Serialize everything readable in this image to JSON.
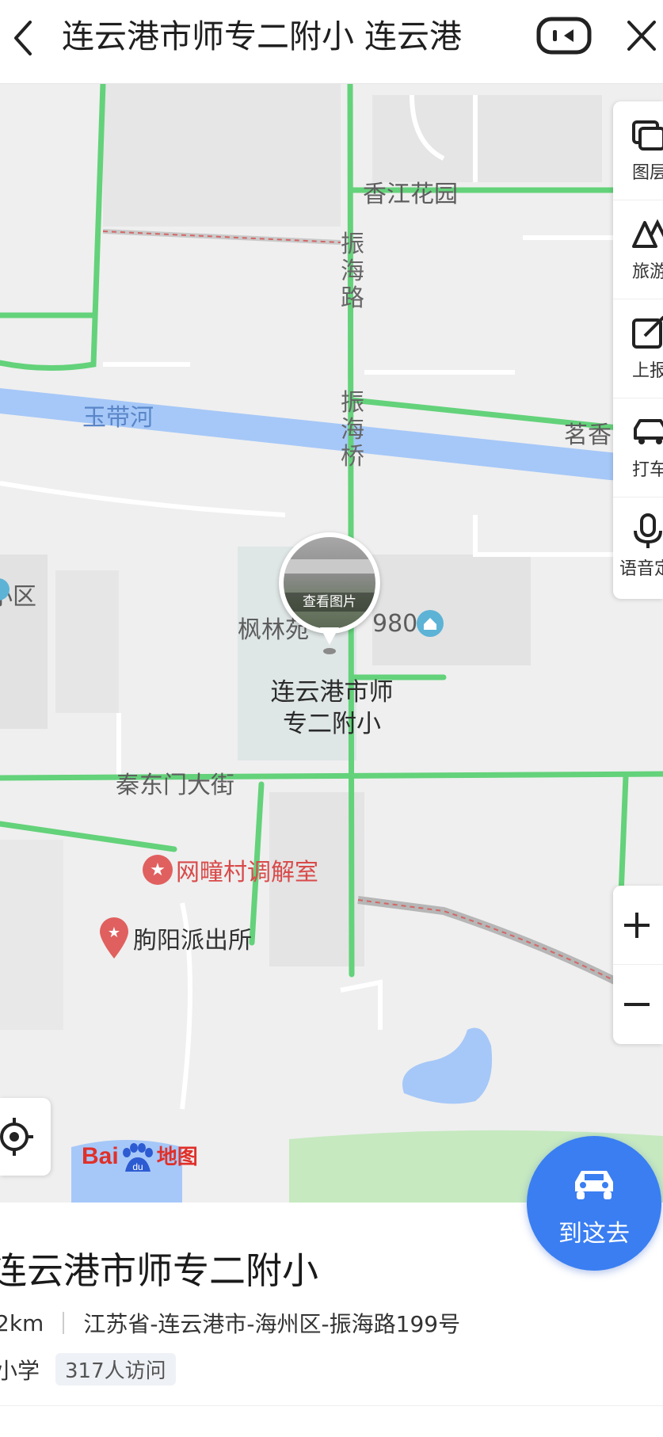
{
  "header": {
    "title": "连云港市师专二附小 连云港",
    "back_icon": "chevron-left-icon",
    "mini_icon": "mini-program-icon",
    "close_icon": "close-icon"
  },
  "map": {
    "labels": {
      "xiangjiang": "香江花园",
      "zhenhai_road": "振海路",
      "zhenhai_bridge": "振海桥",
      "yudai_river": "玉带河",
      "mingxiang": "茗香",
      "xiaoqu": "小区",
      "fenglin": "枫林苑",
      "fenglin_num": "980",
      "qindongmen": "秦东门大街"
    },
    "pois": {
      "mediation": "网疃村调解室",
      "police": "朐阳派出所"
    },
    "pin": {
      "photo_caption": "查看图片",
      "name": "连云港市师专二附小"
    },
    "colors": {
      "road_green": "#63d27a",
      "river": "#a6c8f8",
      "block": "#e2e2e2",
      "park": "#c6e9c0"
    }
  },
  "tools": [
    {
      "label": "图层",
      "icon": "layers-icon"
    },
    {
      "label": "旅游",
      "icon": "travel-icon"
    },
    {
      "label": "上报",
      "icon": "report-icon"
    },
    {
      "label": "打车",
      "icon": "taxi-icon"
    },
    {
      "label": "语音定",
      "icon": "microphone-icon"
    }
  ],
  "zoom": {
    "in_icon": "plus-icon",
    "out_icon": "minus-icon"
  },
  "logo": {
    "bai": "Bai",
    "du": "du",
    "ditu": "地图"
  },
  "go_button": {
    "label": "到这去",
    "icon": "car-icon"
  },
  "info": {
    "name": "连云港市师专二附小",
    "distance": "2km",
    "address": "江苏省-连云港市-海州区-振海路199号",
    "category": "小学",
    "visits": "317人访问"
  }
}
